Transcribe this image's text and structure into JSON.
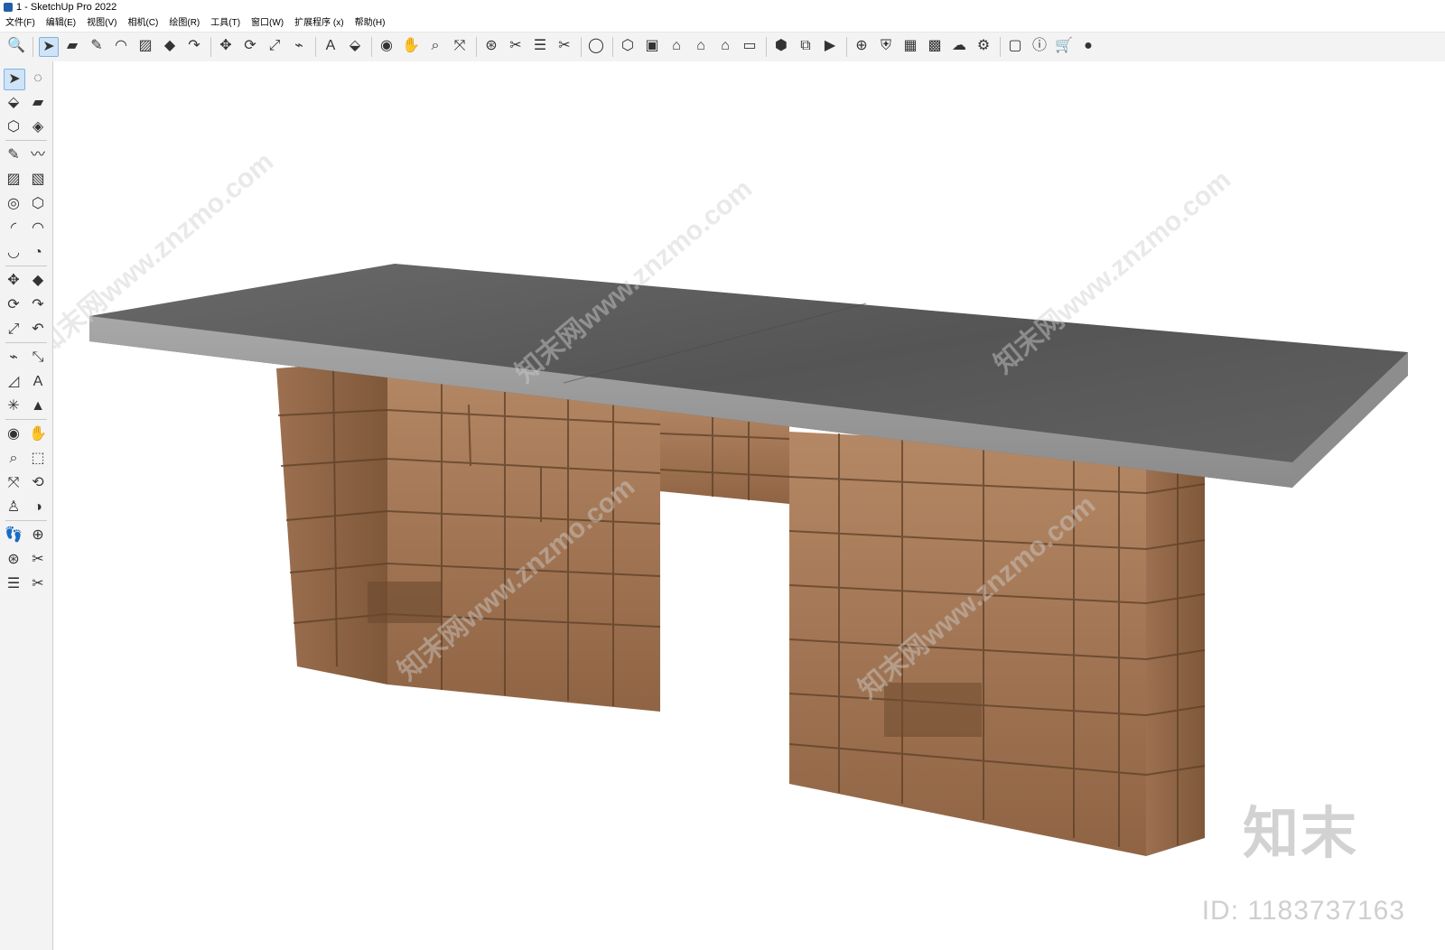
{
  "window": {
    "title": "1 - SketchUp Pro 2022"
  },
  "menu": [
    {
      "label": "文件(F)"
    },
    {
      "label": "编辑(E)"
    },
    {
      "label": "视图(V)"
    },
    {
      "label": "相机(C)"
    },
    {
      "label": "绘图(R)"
    },
    {
      "label": "工具(T)"
    },
    {
      "label": "窗口(W)"
    },
    {
      "label": "扩展程序 (x)"
    },
    {
      "label": "帮助(H)"
    }
  ],
  "toolbar": {
    "icons": [
      {
        "name": "search-icon",
        "glyph": "🔍"
      },
      {
        "name": "select-icon",
        "glyph": "➤"
      },
      {
        "name": "eraser-icon",
        "glyph": "▰"
      },
      {
        "name": "pencil-icon",
        "glyph": "✎"
      },
      {
        "name": "arc-icon",
        "glyph": "◠"
      },
      {
        "name": "rectangle-icon",
        "glyph": "▨"
      },
      {
        "name": "pushpull-icon",
        "glyph": "◆"
      },
      {
        "name": "followme-icon",
        "glyph": "↷"
      },
      {
        "name": "move-icon",
        "glyph": "✥"
      },
      {
        "name": "rotate-icon",
        "glyph": "⟳"
      },
      {
        "name": "scale-icon",
        "glyph": "⤢"
      },
      {
        "name": "tape-measure-icon",
        "glyph": "⌁"
      },
      {
        "name": "text-icon",
        "glyph": "A"
      },
      {
        "name": "paint-bucket-icon",
        "glyph": "⬙"
      },
      {
        "name": "orbit-icon",
        "glyph": "◉"
      },
      {
        "name": "pan-icon",
        "glyph": "✋"
      },
      {
        "name": "zoom-icon",
        "glyph": "⌕"
      },
      {
        "name": "zoom-extents-icon",
        "glyph": "⤧"
      },
      {
        "name": "warehouse-icon",
        "glyph": "⊛"
      },
      {
        "name": "extension-icon",
        "glyph": "✂"
      },
      {
        "name": "layers-icon",
        "glyph": "☰"
      },
      {
        "name": "share-icon",
        "glyph": "✂"
      },
      {
        "name": "user-icon",
        "glyph": "◯"
      },
      {
        "name": "iso-view-icon",
        "glyph": "⬡"
      },
      {
        "name": "right-view-icon",
        "glyph": "▣"
      },
      {
        "name": "home-view-icon",
        "glyph": "⌂"
      },
      {
        "name": "front-view-icon",
        "glyph": "⌂"
      },
      {
        "name": "back-view-icon",
        "glyph": "⌂"
      },
      {
        "name": "left-view-icon",
        "glyph": "▭"
      },
      {
        "name": "solid-tools-icon",
        "glyph": "⬢"
      },
      {
        "name": "section-icon",
        "glyph": "⧉"
      },
      {
        "name": "camera-icon",
        "glyph": "▶"
      },
      {
        "name": "add-icon",
        "glyph": "⊕"
      },
      {
        "name": "shield-icon",
        "glyph": "⛨"
      },
      {
        "name": "chart-icon",
        "glyph": "▦"
      },
      {
        "name": "checker-icon",
        "glyph": "▩"
      },
      {
        "name": "cloud-icon",
        "glyph": "☁"
      },
      {
        "name": "settings-icon",
        "glyph": "⚙"
      },
      {
        "name": "window-icon",
        "glyph": "▢"
      },
      {
        "name": "info-icon",
        "glyph": "ⓘ"
      },
      {
        "name": "cart-icon",
        "glyph": "🛒"
      },
      {
        "name": "account-icon",
        "glyph": "●"
      }
    ]
  },
  "left_toolbar": {
    "icons": [
      {
        "name": "select-icon",
        "glyph": "➤"
      },
      {
        "name": "lasso-icon",
        "glyph": "◌"
      },
      {
        "name": "paint-icon",
        "glyph": "⬙"
      },
      {
        "name": "eraser-icon",
        "glyph": "▰"
      },
      {
        "name": "component-icon",
        "glyph": "⬡"
      },
      {
        "name": "tag-icon",
        "glyph": "◈"
      },
      {
        "name": "line-icon",
        "glyph": "✎"
      },
      {
        "name": "freehand-icon",
        "glyph": "〰"
      },
      {
        "name": "rectangle-icon",
        "glyph": "▨"
      },
      {
        "name": "rotated-rect-icon",
        "glyph": "▧"
      },
      {
        "name": "circle-icon",
        "glyph": "◎"
      },
      {
        "name": "polygon-icon",
        "glyph": "⬡"
      },
      {
        "name": "arc-icon",
        "glyph": "◜"
      },
      {
        "name": "two-point-arc-icon",
        "glyph": "◠"
      },
      {
        "name": "three-point-arc-icon",
        "glyph": "◡"
      },
      {
        "name": "pie-icon",
        "glyph": "◔"
      },
      {
        "name": "move-icon",
        "glyph": "✥"
      },
      {
        "name": "pushpull-icon",
        "glyph": "◆"
      },
      {
        "name": "rotate-icon",
        "glyph": "⟳"
      },
      {
        "name": "followme-icon",
        "glyph": "↷"
      },
      {
        "name": "scale-icon",
        "glyph": "⤢"
      },
      {
        "name": "offset-icon",
        "glyph": "↶"
      },
      {
        "name": "tape-icon",
        "glyph": "⌁"
      },
      {
        "name": "dimension-icon",
        "glyph": "⤡"
      },
      {
        "name": "protractor-icon",
        "glyph": "◿"
      },
      {
        "name": "text-icon",
        "glyph": "A"
      },
      {
        "name": "axes-icon",
        "glyph": "✳"
      },
      {
        "name": "3d-text-icon",
        "glyph": "▲"
      },
      {
        "name": "orbit-icon",
        "glyph": "◉"
      },
      {
        "name": "pan-icon",
        "glyph": "✋"
      },
      {
        "name": "zoom-icon",
        "glyph": "⌕"
      },
      {
        "name": "zoom-window-icon",
        "glyph": "⬚"
      },
      {
        "name": "zoom-extents-icon",
        "glyph": "⤧"
      },
      {
        "name": "previous-view-icon",
        "glyph": "⟲"
      },
      {
        "name": "position-camera-icon",
        "glyph": "♙"
      },
      {
        "name": "look-around-icon",
        "glyph": "◑"
      },
      {
        "name": "walk-icon",
        "glyph": "👣"
      },
      {
        "name": "section-plane-icon",
        "glyph": "⊕"
      },
      {
        "name": "warehouse-icon",
        "glyph": "⊛"
      },
      {
        "name": "extension-warehouse-icon",
        "glyph": "✂"
      },
      {
        "name": "layout-icon",
        "glyph": "☰"
      },
      {
        "name": "share-icon",
        "glyph": "✂"
      }
    ]
  },
  "watermark": {
    "text": "知末网www.znzmo.com",
    "brand": "知末",
    "id": "ID: 1183737163"
  },
  "colors": {
    "top_slab": "#5f5f5f",
    "slab_edge": "#9a9a9a",
    "stone": "#a87a55",
    "stone_dark": "#7d5636",
    "stone_light": "#c79c78",
    "accent": "#1f5fa8"
  }
}
